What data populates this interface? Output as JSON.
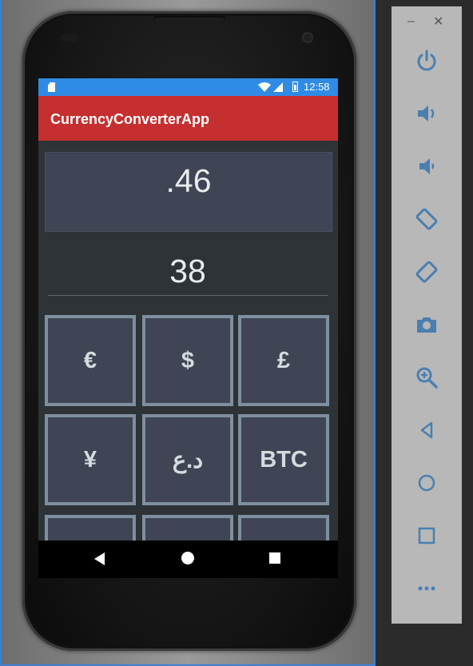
{
  "status_bar": {
    "time": "12:58"
  },
  "app_bar": {
    "title": "CurrencyConverterApp"
  },
  "display": {
    "result": ".46",
    "input": "38"
  },
  "currency_buttons": [
    {
      "label": "€",
      "name": "euro"
    },
    {
      "label": "$",
      "name": "dollar"
    },
    {
      "label": "£",
      "name": "pound"
    },
    {
      "label": "¥",
      "name": "yen"
    },
    {
      "label": "د.ع",
      "name": "iraqi-dinar"
    },
    {
      "label": "BTC",
      "name": "bitcoin"
    }
  ],
  "toolbar": {
    "minimize": "–",
    "close": "✕",
    "buttons": [
      "power-icon",
      "volume-up-icon",
      "volume-down-icon",
      "rotate-left-icon",
      "rotate-right-icon",
      "camera-icon",
      "zoom-icon",
      "back-icon",
      "home-icon",
      "overview-icon",
      "more-icon"
    ]
  },
  "colors": {
    "status_bar": "#2f8be6",
    "app_bar": "#c62f2f",
    "screen_bg": "#2e3337",
    "button_bg": "#3f4554",
    "button_border": "#7f8fa0",
    "toolbar_icon": "#4a7fb0"
  }
}
